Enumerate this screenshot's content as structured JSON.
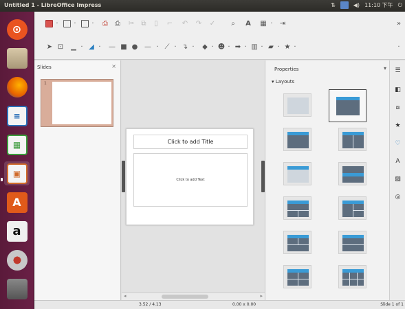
{
  "window": {
    "title": "Untitled 1 - LibreOffice Impress"
  },
  "tray": {
    "clock": "11:10 下午",
    "volume_icon": "volume-icon",
    "power_icon": "power-icon"
  },
  "launcher": {
    "items": [
      {
        "name": "ubuntu-home",
        "icon": "ubuntu-logo-icon",
        "color": "#e95420"
      },
      {
        "name": "files",
        "icon": "files-icon",
        "color": "#c8b89a"
      },
      {
        "name": "firefox",
        "icon": "firefox-icon",
        "color": "#e66000"
      },
      {
        "name": "writer",
        "icon": "writer-icon",
        "color": "#2a6fb8"
      },
      {
        "name": "calc",
        "icon": "calc-icon",
        "color": "#3a9a3a"
      },
      {
        "name": "impress",
        "icon": "impress-icon",
        "color": "#d06a29"
      },
      {
        "name": "software-center",
        "icon": "software-center-icon",
        "color": "#e05a1a"
      },
      {
        "name": "amazon",
        "icon": "amazon-icon",
        "color": "#f0f0f0"
      },
      {
        "name": "settings",
        "icon": "settings-icon",
        "color": "#b8b8b8"
      },
      {
        "name": "trash",
        "icon": "trash-icon",
        "color": "#666666"
      }
    ],
    "labels": {
      "software_center": "A",
      "amazon": "a"
    }
  },
  "slides_pane": {
    "title": "Slides",
    "slide_number": "1"
  },
  "slide": {
    "title_placeholder": "Click to add Title",
    "text_placeholder": "Click to add Text"
  },
  "sidebar": {
    "title": "Properties",
    "section": "Layouts"
  },
  "status": {
    "slide_info": "Slide 1 of 1",
    "position": "3.52 / 4.13",
    "size": "0.00 x 0.00"
  },
  "colors": {
    "accent": "#3a9bd6",
    "launcher_bg": "#5a1a3a",
    "panel_bg": "#3c3b37"
  }
}
